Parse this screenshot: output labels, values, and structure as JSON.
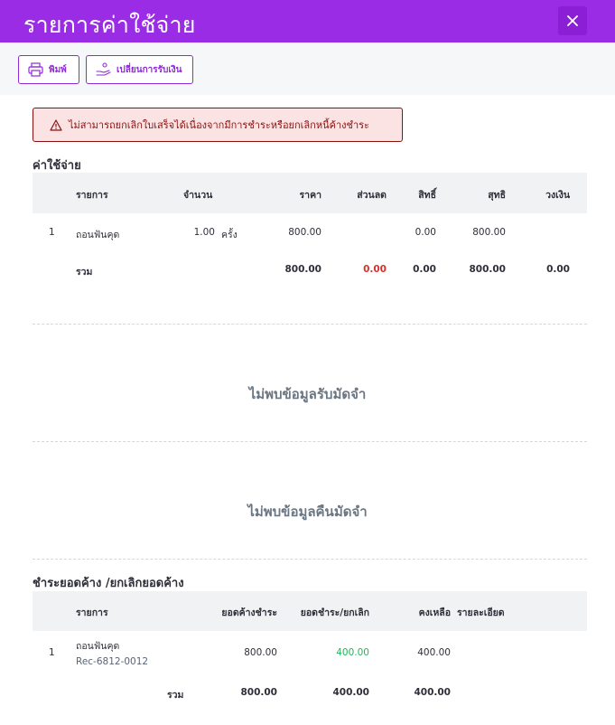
{
  "header": {
    "title": "รายการค่าใช้จ่าย",
    "close_icon": "close-icon"
  },
  "toolbar": {
    "print_label": "พิมพ์",
    "change_payment_label": "เปลี่ยนการรับเงิน"
  },
  "alert": {
    "message": "ไม่สามารถยกเลิกใบเสร็จได้เนื่องจากมีการชำระหรือยกเลิกหนี้ค้างชำระ"
  },
  "expenses": {
    "title": "ค่าใช้จ่าย",
    "columns": [
      "รายการ",
      "จำนวน",
      "ราคา",
      "ส่วนลด",
      "สิทธิ์",
      "สุทธิ",
      "วงเงิน"
    ],
    "rows": [
      {
        "index": "1",
        "item": "ถอนฟันคุด",
        "qty": "1.00",
        "unit": "ครั้ง",
        "price": "800.00",
        "discount": "",
        "rights": "0.00",
        "net": "800.00",
        "limit": ""
      }
    ],
    "total": {
      "label": "รวม",
      "price": "800.00",
      "discount": "0.00",
      "rights": "0.00",
      "net": "800.00",
      "limit": "0.00"
    }
  },
  "deposit_empty": "ไม่พบข้อมูลรับมัดจำ",
  "refund_empty": "ไม่พบข้อมูลคืนมัดจำ",
  "outstanding": {
    "title": "ชำระยอดค้าง /ยกเลิกยอดค้าง",
    "columns": [
      "รายการ",
      "ยอดค้างชำระ",
      "ยอดชำระ/ยกเลิก",
      "คงเหลือ",
      "รายละเอียด"
    ],
    "rows": [
      {
        "index": "1",
        "item": "ถอนฟันคุด",
        "ref": "Rec-6812-0012",
        "owed": "800.00",
        "paid": "400.00",
        "remaining": "400.00"
      }
    ],
    "total": {
      "label": "รวม",
      "owed": "800.00",
      "paid": "400.00",
      "remaining": "400.00"
    }
  },
  "colors": {
    "brand": "#9b2ce5",
    "alert_text": "#8a1010",
    "discount_red": "#d8322c",
    "paid_green": "#26b35a"
  }
}
